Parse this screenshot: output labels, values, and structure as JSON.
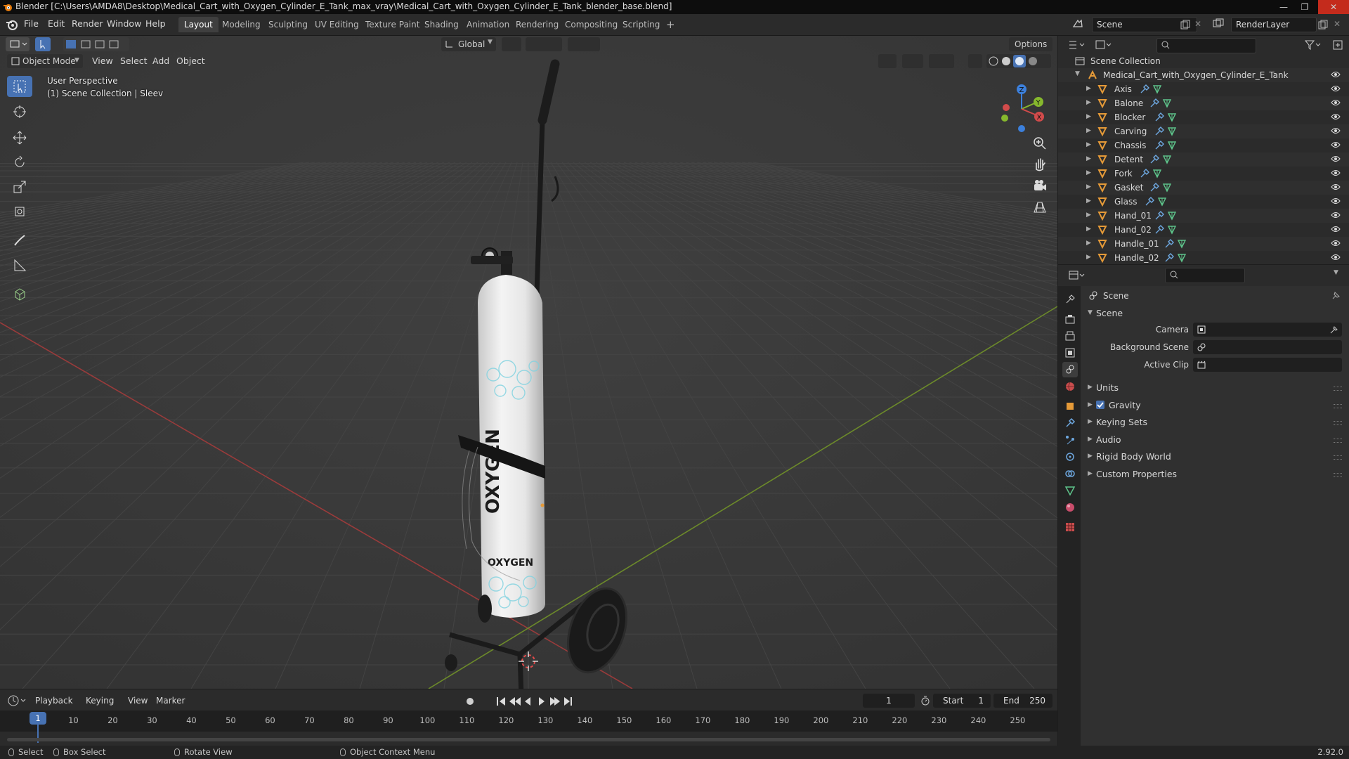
{
  "window": {
    "title": "Blender [C:\\Users\\AMDA8\\Desktop\\Medical_Cart_with_Oxygen_Cylinder_E_Tank_max_vray\\Medical_Cart_with_Oxygen_Cylinder_E_Tank_blender_base.blend]"
  },
  "menu": [
    "File",
    "Edit",
    "Render",
    "Window",
    "Help"
  ],
  "workspace_tabs": [
    "Layout",
    "Modeling",
    "Sculpting",
    "UV Editing",
    "Texture Paint",
    "Shading",
    "Animation",
    "Rendering",
    "Compositing",
    "Scripting"
  ],
  "workspace_active": "Layout",
  "add_tab_symbol": "+",
  "scene_selector": "Scene",
  "view_layer_selector": "RenderLayer",
  "viewport": {
    "mode": "Object Mode",
    "menus": [
      "View",
      "Select",
      "Add",
      "Object"
    ],
    "orientation": "Global",
    "options_label": "Options",
    "perspective_label": "User Perspective",
    "collection_label": "(1) Scene Collection | Sleev",
    "gizmo_axes": [
      "X",
      "Y",
      "Z"
    ],
    "tank_text": "OXYGEN"
  },
  "outliner": {
    "root": "Scene Collection",
    "collection": "Medical_Cart_with_Oxygen_Cylinder_E_Tank",
    "objects": [
      "Axis",
      "Balone",
      "Blocker",
      "Carving",
      "Chassis",
      "Detent",
      "Fork",
      "Gasket",
      "Glass",
      "Hand_01",
      "Hand_02",
      "Handle_01",
      "Handle_02"
    ]
  },
  "properties": {
    "context": "Scene",
    "panel": "Scene",
    "fields": [
      {
        "label": "Camera",
        "value": ""
      },
      {
        "label": "Background Scene",
        "value": ""
      },
      {
        "label": "Active Clip",
        "value": ""
      }
    ],
    "subpanels": [
      {
        "label": "Units",
        "checkbox": false
      },
      {
        "label": "Gravity",
        "checkbox": true
      },
      {
        "label": "Keying Sets",
        "checkbox": false
      },
      {
        "label": "Audio",
        "checkbox": false
      },
      {
        "label": "Rigid Body World",
        "checkbox": false
      },
      {
        "label": "Custom Properties",
        "checkbox": false
      }
    ]
  },
  "timeline": {
    "menus": [
      "Playback",
      "Keying",
      "View",
      "Marker"
    ],
    "current_frame": "1",
    "start_label": "Start",
    "start": "1",
    "end_label": "End",
    "end": "250",
    "ruler": [
      "1",
      "10",
      "20",
      "30",
      "40",
      "50",
      "60",
      "70",
      "80",
      "90",
      "100",
      "110",
      "120",
      "130",
      "140",
      "150",
      "160",
      "170",
      "180",
      "190",
      "200",
      "210",
      "220",
      "230",
      "240",
      "250"
    ]
  },
  "statusbar": {
    "select": "Select",
    "box_select": "Box Select",
    "rotate": "Rotate View",
    "context_menu": "Object Context Menu",
    "version": "2.92.0"
  },
  "colors": {
    "accent": "#4772b3",
    "object_icon": "#e59a38",
    "mesh_icon": "#5ec48b",
    "modifier_icon": "#6ea8e0",
    "x_axis": "#d24b4b",
    "y_axis": "#86b82d",
    "z_axis": "#3c80dc"
  }
}
